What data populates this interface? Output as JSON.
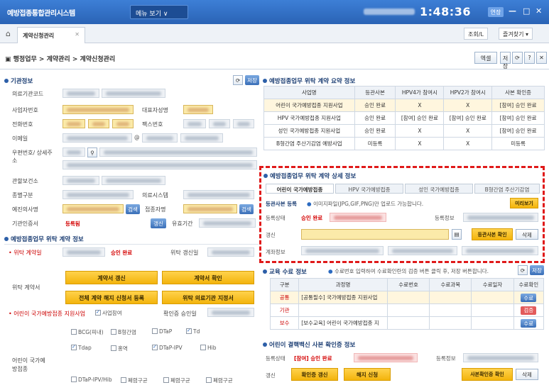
{
  "titlebar": {
    "app_title": "예방접종통합관리시스템",
    "menu_label": "메뉴 보기 ∨",
    "clock": "1:48:36",
    "ext_label": "연장",
    "minimize": "—",
    "restore": "□",
    "close": "✕"
  },
  "tabbar": {
    "tab_label": "계약신청관리",
    "tab_close": "✕",
    "menu_btn": "조회/L",
    "fav_btn": "즐겨찾기 ▾"
  },
  "breadcrumb": "▣ 행정업무 > 계약관리 > 계약신청관리",
  "toolbar": {
    "excel": "엑셀",
    "save": "저장",
    "refresh": "⟳",
    "help": "?",
    "close": "✕"
  },
  "left": {
    "section_basic": "기관정보",
    "fields": [
      {
        "label": "의료기관코드"
      },
      {
        "label": "사업자번호",
        "label2": "대표자성명"
      },
      {
        "label": "전화번호",
        "label2": "팩스번호"
      },
      {
        "label": "이메일",
        "at": "@"
      },
      {
        "label": "우편번호/ 상세주소"
      },
      {
        "label": "관할보건소"
      },
      {
        "label": "종별구분",
        "label2": "의료시스템"
      },
      {
        "label": "예진의사명",
        "btn": "검색",
        "label3": "접종자명",
        "btn2": "검색"
      },
      {
        "label": "기관인증서",
        "status": "등록됨",
        "btn": "갱신",
        "label2": "유효기간"
      }
    ],
    "save_btn": "저장",
    "section_contract": "예방접종업무 위탁 계약 정보",
    "contract_date_label": "• 위탁 계약일",
    "contract_status": "승인 완료",
    "renew_date_label": "위탁 갱신일",
    "contract_doc_label": "위탁 계약서",
    "btn_renew": "계약서 갱신",
    "btn_confirm": "계약서 확인",
    "btn_cancel": "전체 계약 해지 신청서 등록",
    "btn_period": "위탁 의료기관 지정서",
    "child_label": "• 어린이 국가예방접종 지원사업",
    "child_check": "사업참여",
    "child_confirm_label": "확인증 승인일",
    "vaccine_section_label": "어린이 국가예방접종",
    "vaccines": [
      "BCG(피내)",
      "B형간염",
      "DTaP",
      "Td",
      "Tdap",
      "홍역",
      "DTaP-IPV",
      "Hib"
    ],
    "vaccines_row3": [
      "DTaP-IPV/Hib",
      "폐렴구균",
      "폐렴구균",
      "폐렴구균"
    ]
  },
  "summary": {
    "title": "예방접종업무 위탁 계약 요약 정보",
    "headers": [
      "사업명",
      "등관사본",
      "HPV4가 참여시",
      "HPV2가 참여시",
      "사본 확인증"
    ],
    "rows": [
      [
        "어린이 국가예방접종 지원사업",
        "승인 완료",
        "X",
        "X",
        "[참여] 승인 완료"
      ],
      [
        "HPV 국가예방접종 지원사업",
        "승인 완료",
        "[참여] 승인 완료",
        "[참여] 승인 완료",
        "[참여] 승인 완료"
      ],
      [
        "성인 국가예방접종 지원사업",
        "승인 완료",
        "X",
        "X",
        "[참여] 승인 완료"
      ],
      [
        "B형간염 주산기감염 예방사업",
        "미등록",
        "X",
        "X",
        "미등록"
      ]
    ]
  },
  "detail": {
    "title": "예방접종업무 위탁 계약 상세 정보",
    "tabs": [
      "어린이 국가예방접종",
      "HPV 국가예방접종",
      "성인 국가예방접종",
      "B형간염 주산기감염"
    ],
    "reg_label": "등관사본 등록",
    "reg_hint": "이미지파일(JPG,GIF,PNG)만 업로드 가능합니다.",
    "reg_btn": "미리보기",
    "status_label": "등록상태",
    "status_value": "승인 완료",
    "info_label": "등록정보",
    "change_label": "갱신",
    "confirm_btn": "등관사본 확인",
    "delete_btn": "삭제",
    "account_label": "계좌정보"
  },
  "education": {
    "title": "교육 수료 정보",
    "hint": "수료번호 입력하여 수료확인란의 검증 버튼 클릭 후, 저장 버튼합니다.",
    "headers": [
      "구분",
      "과정명",
      "수료번호",
      "수료과목",
      "수료일자",
      "수료확인"
    ],
    "rows": [
      {
        "type": "공통",
        "name": "[공통필수] 국가예방접종 지원사업",
        "result": "수료"
      },
      {
        "type": "기관",
        "name": "",
        "result": "검증"
      },
      {
        "type": "보수",
        "name": "[보수교육] 어린이 국가예방접종 지",
        "result": "수료"
      }
    ]
  },
  "hpv": {
    "title": "어린이 결핵백신 사본 확인증 정보",
    "status_label": "등록상태",
    "status_value": "[참여] 승인 완료",
    "info_label": "등록정보",
    "change_label": "갱신",
    "renew_btn": "확인증 갱신",
    "cancel_btn": "해지 신청",
    "confirm_btn": "사본확인증 확인",
    "delete_btn": "삭제"
  },
  "colors": {
    "accent": "#2a63b5",
    "highlight": "#e01a1a",
    "button_yellow": "#f7c21f"
  }
}
